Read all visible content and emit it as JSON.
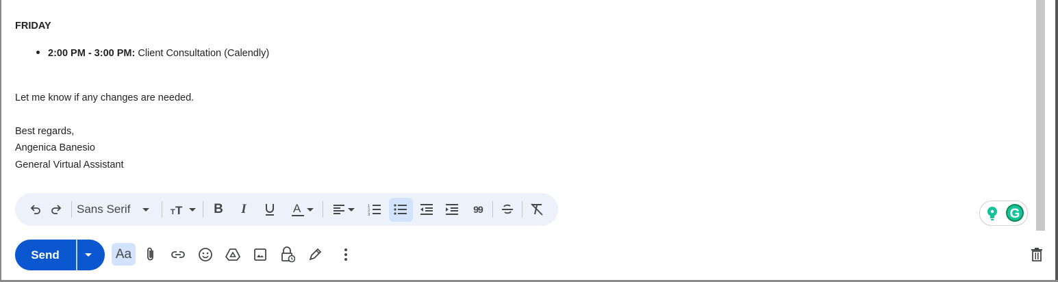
{
  "email_body": {
    "day_heading": "FRIDAY",
    "events": [
      {
        "time": "2:00 PM - 3:00 PM:",
        "title": "Client Consultation (Calendly)"
      }
    ],
    "closing_line": "Let me know if any changes are needed.",
    "signature": {
      "sign_off": "Best regards,",
      "name": "Angenica Banesio",
      "role": "General Virtual Assistant"
    }
  },
  "format_toolbar": {
    "font_family": "Sans Serif",
    "icons": [
      "undo-icon",
      "redo-icon",
      "text-size-icon",
      "bold-icon",
      "italic-icon",
      "underline-icon",
      "text-color-icon",
      "align-icon",
      "numbered-list-icon",
      "bulleted-list-icon",
      "indent-less-icon",
      "indent-more-icon",
      "quote-icon",
      "strikethrough-icon",
      "remove-formatting-icon"
    ],
    "active": "bulleted-list"
  },
  "compose_actions": {
    "send_label": "Send",
    "formatting_label": "Aa",
    "icons": [
      "paperclip-icon",
      "link-icon",
      "emoji-icon",
      "drive-icon",
      "photo-icon",
      "confidential-lock-icon",
      "signature-pen-icon",
      "more-options-icon",
      "trash-icon"
    ]
  },
  "colors": {
    "send_button": "#0b57d0",
    "toolbar_bg": "#edf2fa",
    "active_bg": "#d3e3fd",
    "grammarly_green": "#15c39a",
    "grammarly_badge": "#0c8a55"
  }
}
